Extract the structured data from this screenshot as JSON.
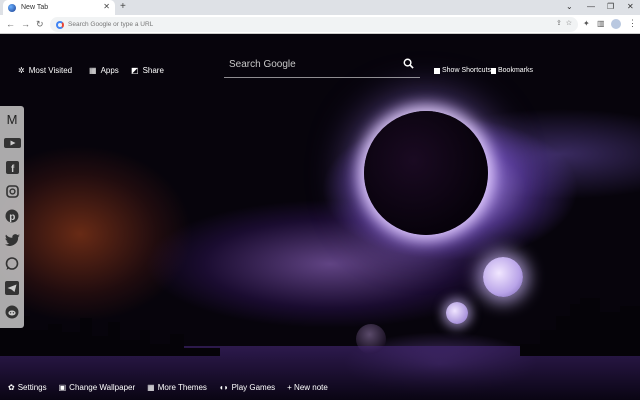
{
  "browser": {
    "tab_title": "New Tab",
    "omnibox_placeholder": "Search Google or type a URL"
  },
  "topnav": {
    "most_visited": "Most Visited",
    "apps": "Apps",
    "share": "Share"
  },
  "search": {
    "placeholder": "Search Google"
  },
  "rightlinks": {
    "show_shortcuts": "Show Shortcuts",
    "bookmarks": "Bookmarks"
  },
  "social": [
    "gmail-icon",
    "youtube-icon",
    "facebook-icon",
    "instagram-icon",
    "pinterest-icon",
    "twitter-icon",
    "whatsapp-icon",
    "telegram-icon",
    "reddit-icon"
  ],
  "bottombar": {
    "settings": "Settings",
    "change_wallpaper": "Change Wallpaper",
    "more_themes": "More Themes",
    "play_games": "Play Games",
    "new_note": "+ New note"
  },
  "colors": {
    "accent": "#8f6cff",
    "background": "#07040c"
  }
}
